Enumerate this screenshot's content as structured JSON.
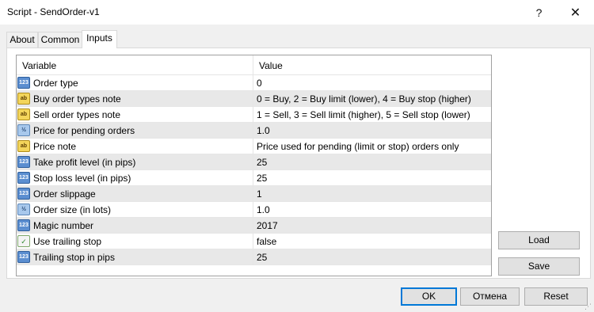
{
  "window": {
    "title": "Script - SendOrder-v1",
    "help_glyph": "?",
    "close_glyph": "✕"
  },
  "tabs": [
    {
      "label": "About"
    },
    {
      "label": "Common"
    },
    {
      "label": "Inputs"
    }
  ],
  "active_tab": "Inputs",
  "grid": {
    "columns": [
      "Variable",
      "Value"
    ],
    "rows": [
      {
        "icon": "int-type-icon",
        "badge": "123",
        "name": "Order type",
        "value": "0"
      },
      {
        "icon": "string-type-icon",
        "badge": "ab",
        "name": "Buy order types note",
        "value": "0 = Buy, 2 = Buy limit (lower), 4 = Buy stop (higher)"
      },
      {
        "icon": "string-type-icon",
        "badge": "ab",
        "name": "Sell order types note",
        "value": "1 = Sell, 3 = Sell limit (higher), 5 = Sell stop (lower)"
      },
      {
        "icon": "double-type-icon",
        "badge": "½",
        "name": "Price for pending orders",
        "value": "1.0"
      },
      {
        "icon": "string-type-icon",
        "badge": "ab",
        "name": "Price note",
        "value": "Price used for pending (limit or stop) orders only"
      },
      {
        "icon": "int-type-icon",
        "badge": "123",
        "name": "Take profit level (in pips)",
        "value": "25"
      },
      {
        "icon": "int-type-icon",
        "badge": "123",
        "name": "Stop loss level (in pips)",
        "value": "25"
      },
      {
        "icon": "int-type-icon",
        "badge": "123",
        "name": "Order slippage",
        "value": "1"
      },
      {
        "icon": "double-type-icon",
        "badge": "½",
        "name": "Order size (in lots)",
        "value": "1.0"
      },
      {
        "icon": "int-type-icon",
        "badge": "123",
        "name": "Magic number",
        "value": "2017"
      },
      {
        "icon": "bool-type-icon",
        "badge": "✓",
        "name": "Use trailing stop",
        "value": "false"
      },
      {
        "icon": "int-type-icon",
        "badge": "123",
        "name": "Trailing stop in pips",
        "value": "25"
      }
    ]
  },
  "buttons": {
    "load": "Load",
    "save": "Save",
    "ok": "OK",
    "cancel": "Отмена",
    "reset": "Reset"
  },
  "colors": {
    "selected_button_border": "#0078d7",
    "alt_row_background": "#e8e8e8"
  }
}
